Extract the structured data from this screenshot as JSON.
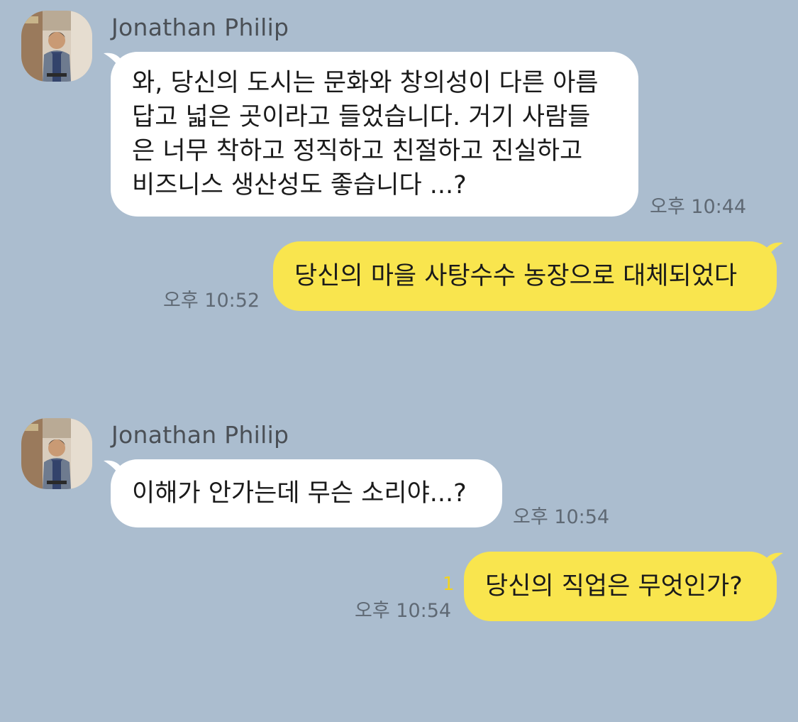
{
  "theme": {
    "background": "#abbdcf",
    "incoming_bubble": "#ffffff",
    "outgoing_bubble": "#f9e54e",
    "unread_color": "#f2d21e"
  },
  "messages": [
    {
      "direction": "incoming",
      "sender": "Jonathan Philip",
      "avatar_icon": "profile-photo",
      "lines": [
        "와, 당신의 도시는 문화와 창의성이 다른 아름",
        "답고 넓은 곳이라고 들었습니다. 거기 사람들",
        "은 너무 착하고 정직하고 친절하고 진실하고",
        "비즈니스 생산성도 좋습니다 ...?"
      ],
      "time": "오후 10:44"
    },
    {
      "direction": "outgoing",
      "text": "당신의 마을 사탕수수 농장으로 대체되었다",
      "time": "오후 10:52"
    },
    {
      "direction": "incoming",
      "sender": "Jonathan Philip",
      "avatar_icon": "profile-photo",
      "text": "이해가 안가는데 무슨 소리야...?",
      "time": "오후 10:54"
    },
    {
      "direction": "outgoing",
      "text": "당신의 직업은 무엇인가?",
      "time": "오후 10:54",
      "unread_count": "1"
    }
  ]
}
